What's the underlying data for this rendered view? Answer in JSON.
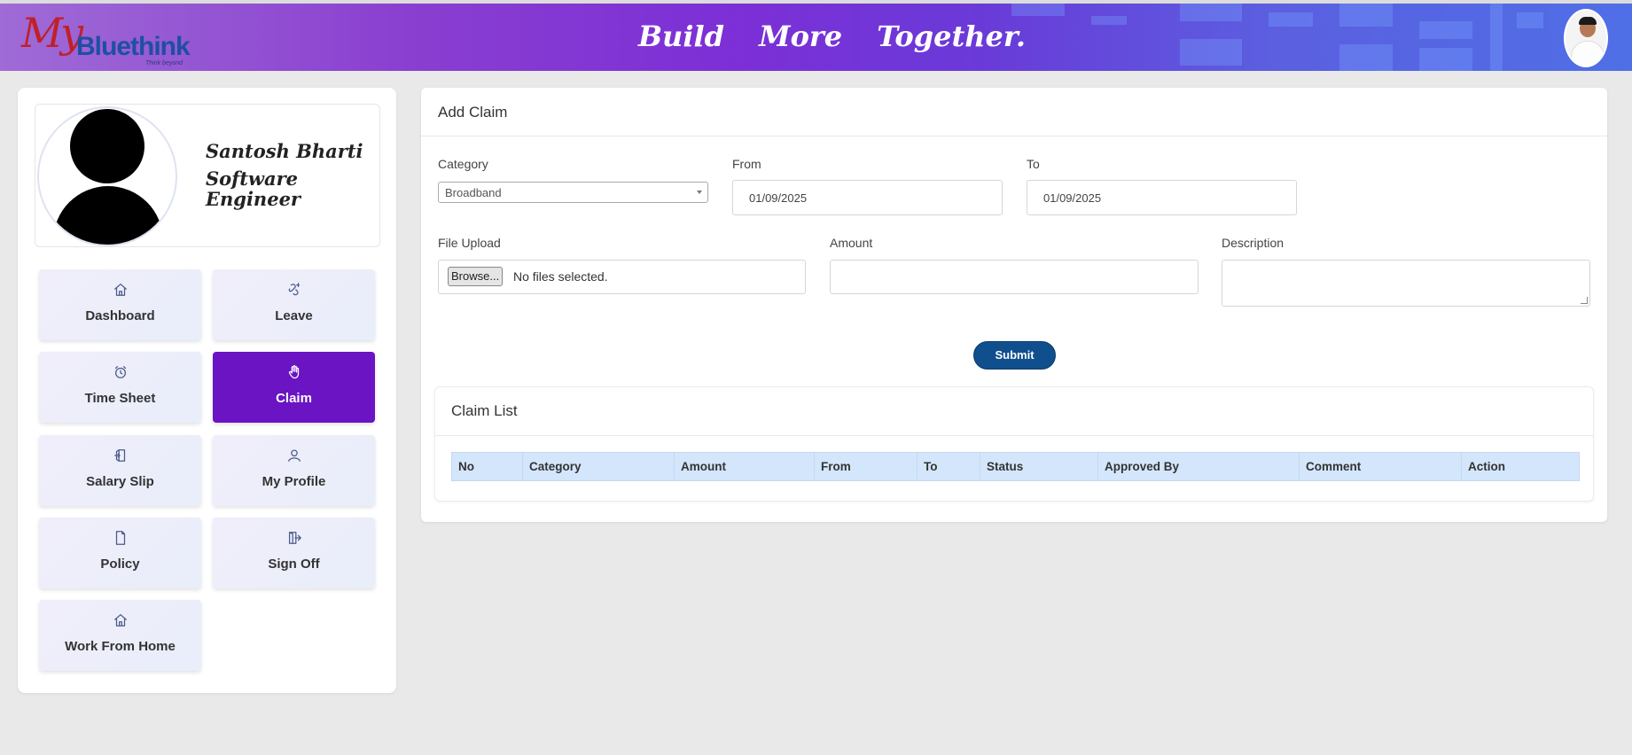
{
  "header": {
    "logo_my": "My",
    "logo_brand": "Bluethink",
    "logo_tagline": "Think beyond",
    "tagline": "Build More Together."
  },
  "profile": {
    "name": "Santosh Bharti",
    "role": "Software Engineer"
  },
  "nav": [
    {
      "label": "Dashboard",
      "icon": "home-icon",
      "active": false
    },
    {
      "label": "Leave",
      "icon": "leave-icon",
      "active": false
    },
    {
      "label": "Time Sheet",
      "icon": "clock-icon",
      "active": false
    },
    {
      "label": "Claim",
      "icon": "hand-icon",
      "active": true
    },
    {
      "label": "Salary Slip",
      "icon": "salary-icon",
      "active": false
    },
    {
      "label": "My Profile",
      "icon": "user-icon",
      "active": false
    },
    {
      "label": "Policy",
      "icon": "document-icon",
      "active": false
    },
    {
      "label": "Sign Off",
      "icon": "signoff-icon",
      "active": false
    },
    {
      "label": "Work From Home",
      "icon": "home-icon",
      "active": false
    }
  ],
  "form": {
    "title": "Add Claim",
    "category_label": "Category",
    "category_value": "Broadband",
    "from_label": "From",
    "from_value": "01/09/2025",
    "to_label": "To",
    "to_value": "01/09/2025",
    "file_label": "File Upload",
    "browse_label": "Browse...",
    "file_status": "No files selected.",
    "amount_label": "Amount",
    "amount_value": "",
    "description_label": "Description",
    "submit_label": "Submit"
  },
  "claim_list": {
    "title": "Claim List",
    "columns": [
      "No",
      "Category",
      "Amount",
      "From",
      "To",
      "Status",
      "Approved By",
      "Comment",
      "Action"
    ],
    "rows": []
  },
  "colors": {
    "accent": "#6a14c4",
    "submit": "#0f4f8e",
    "table_header": "#d3e6fb"
  }
}
